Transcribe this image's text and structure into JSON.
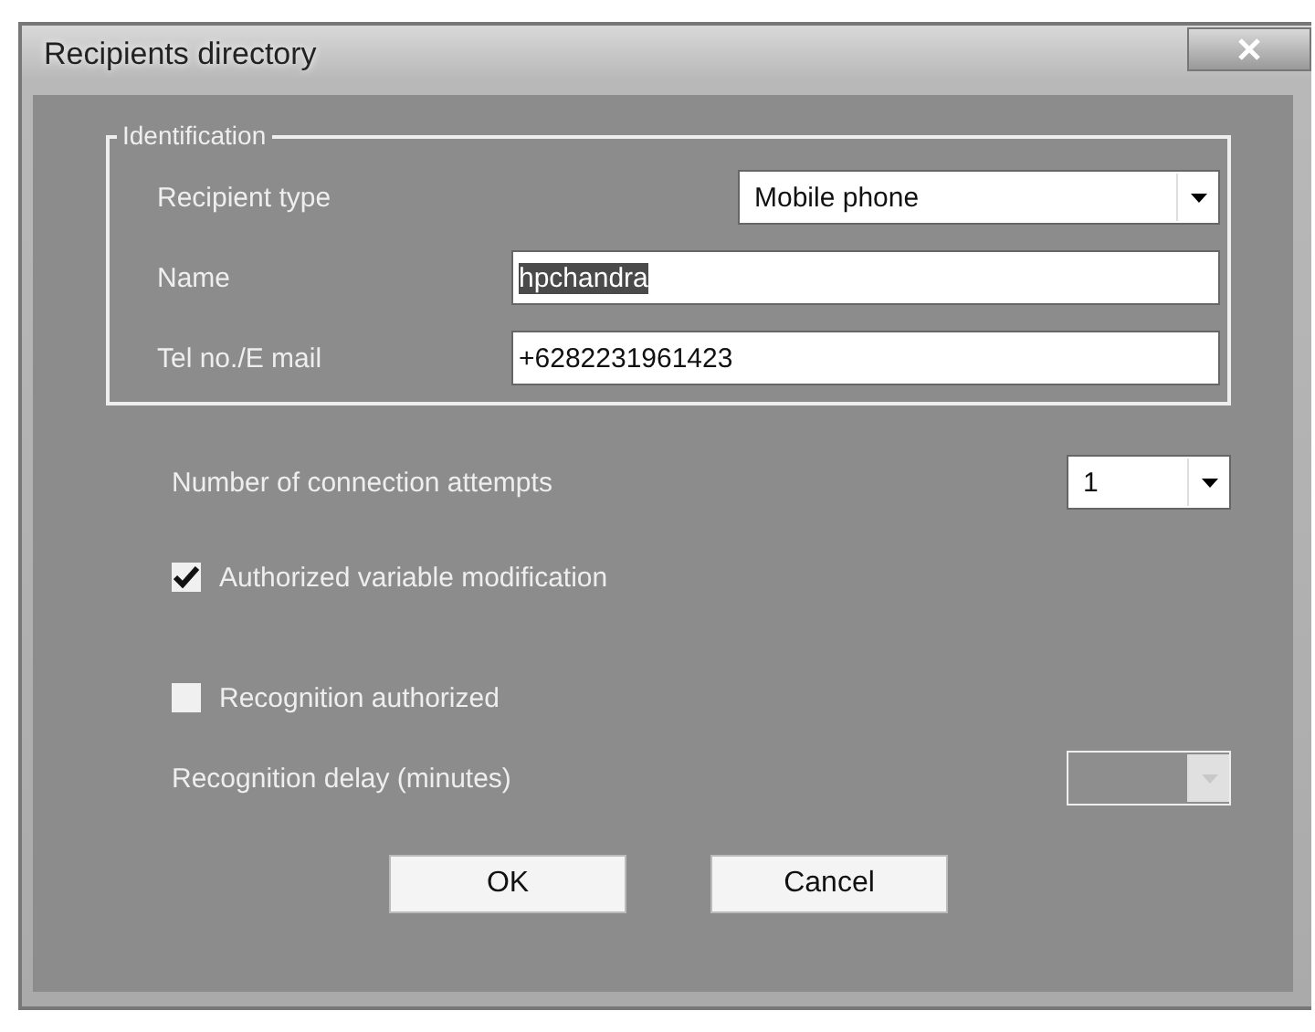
{
  "window": {
    "title": "Recipients directory"
  },
  "identification": {
    "legend": "Identification",
    "fields": [
      {
        "kind": "combo",
        "label": "Recipient type",
        "value": "Mobile phone"
      },
      {
        "kind": "text",
        "label": "Name",
        "value": "hpchandra",
        "text_selected": true
      },
      {
        "kind": "text",
        "label": "Tel no./E mail",
        "value": "+6282231961423"
      }
    ]
  },
  "attempts": {
    "label": "Number of connection attempts",
    "value": "1",
    "disabled": false
  },
  "checkboxes": [
    {
      "label": "Authorized variable modification",
      "checked": true
    },
    {
      "label": "Recognition authorized",
      "checked": false
    }
  ],
  "delay": {
    "label": "Recognition delay (minutes)",
    "disabled": true
  },
  "buttons": [
    "OK",
    "Cancel"
  ]
}
